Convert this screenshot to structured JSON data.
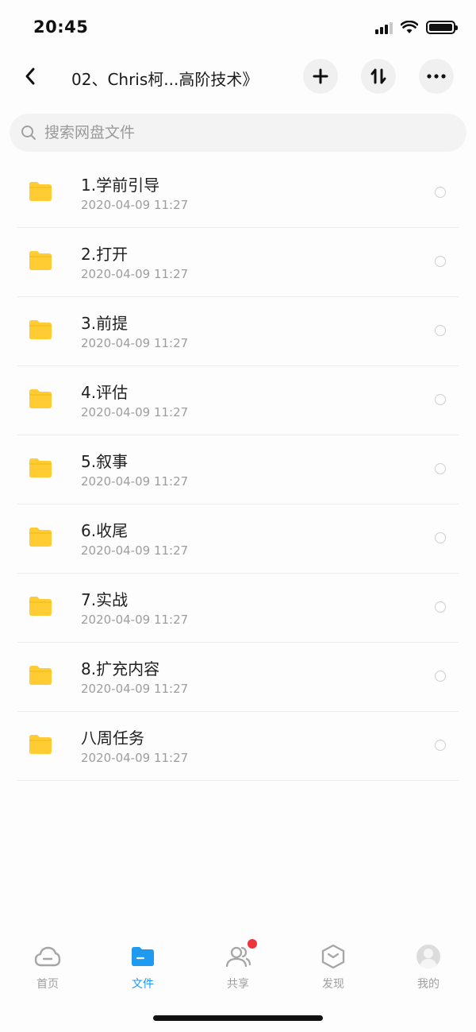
{
  "status": {
    "time": "20:45"
  },
  "header": {
    "title": "02、Chris柯...高阶技术》"
  },
  "search": {
    "placeholder": "搜索网盘文件"
  },
  "files": [
    {
      "name": "1.学前引导",
      "date": "2020-04-09 11:27"
    },
    {
      "name": "2.打开",
      "date": "2020-04-09 11:27"
    },
    {
      "name": "3.前提",
      "date": "2020-04-09 11:27"
    },
    {
      "name": "4.评估",
      "date": "2020-04-09 11:27"
    },
    {
      "name": "5.叙事",
      "date": "2020-04-09 11:27"
    },
    {
      "name": "6.收尾",
      "date": "2020-04-09 11:27"
    },
    {
      "name": "7.实战",
      "date": "2020-04-09 11:27"
    },
    {
      "name": "8.扩充内容",
      "date": "2020-04-09 11:27"
    },
    {
      "name": "八周任务",
      "date": "2020-04-09 11:27"
    }
  ],
  "tabs": [
    {
      "label": "首页",
      "icon": "cloud-icon"
    },
    {
      "label": "文件",
      "icon": "folder-icon",
      "active": true
    },
    {
      "label": "共享",
      "icon": "people-icon"
    },
    {
      "label": "发现",
      "icon": "discover-icon"
    },
    {
      "label": "我的",
      "icon": "avatar-icon"
    }
  ],
  "colors": {
    "accent": "#1e9bf0",
    "folder": "#ffcc33",
    "badge": "#f0353a"
  }
}
